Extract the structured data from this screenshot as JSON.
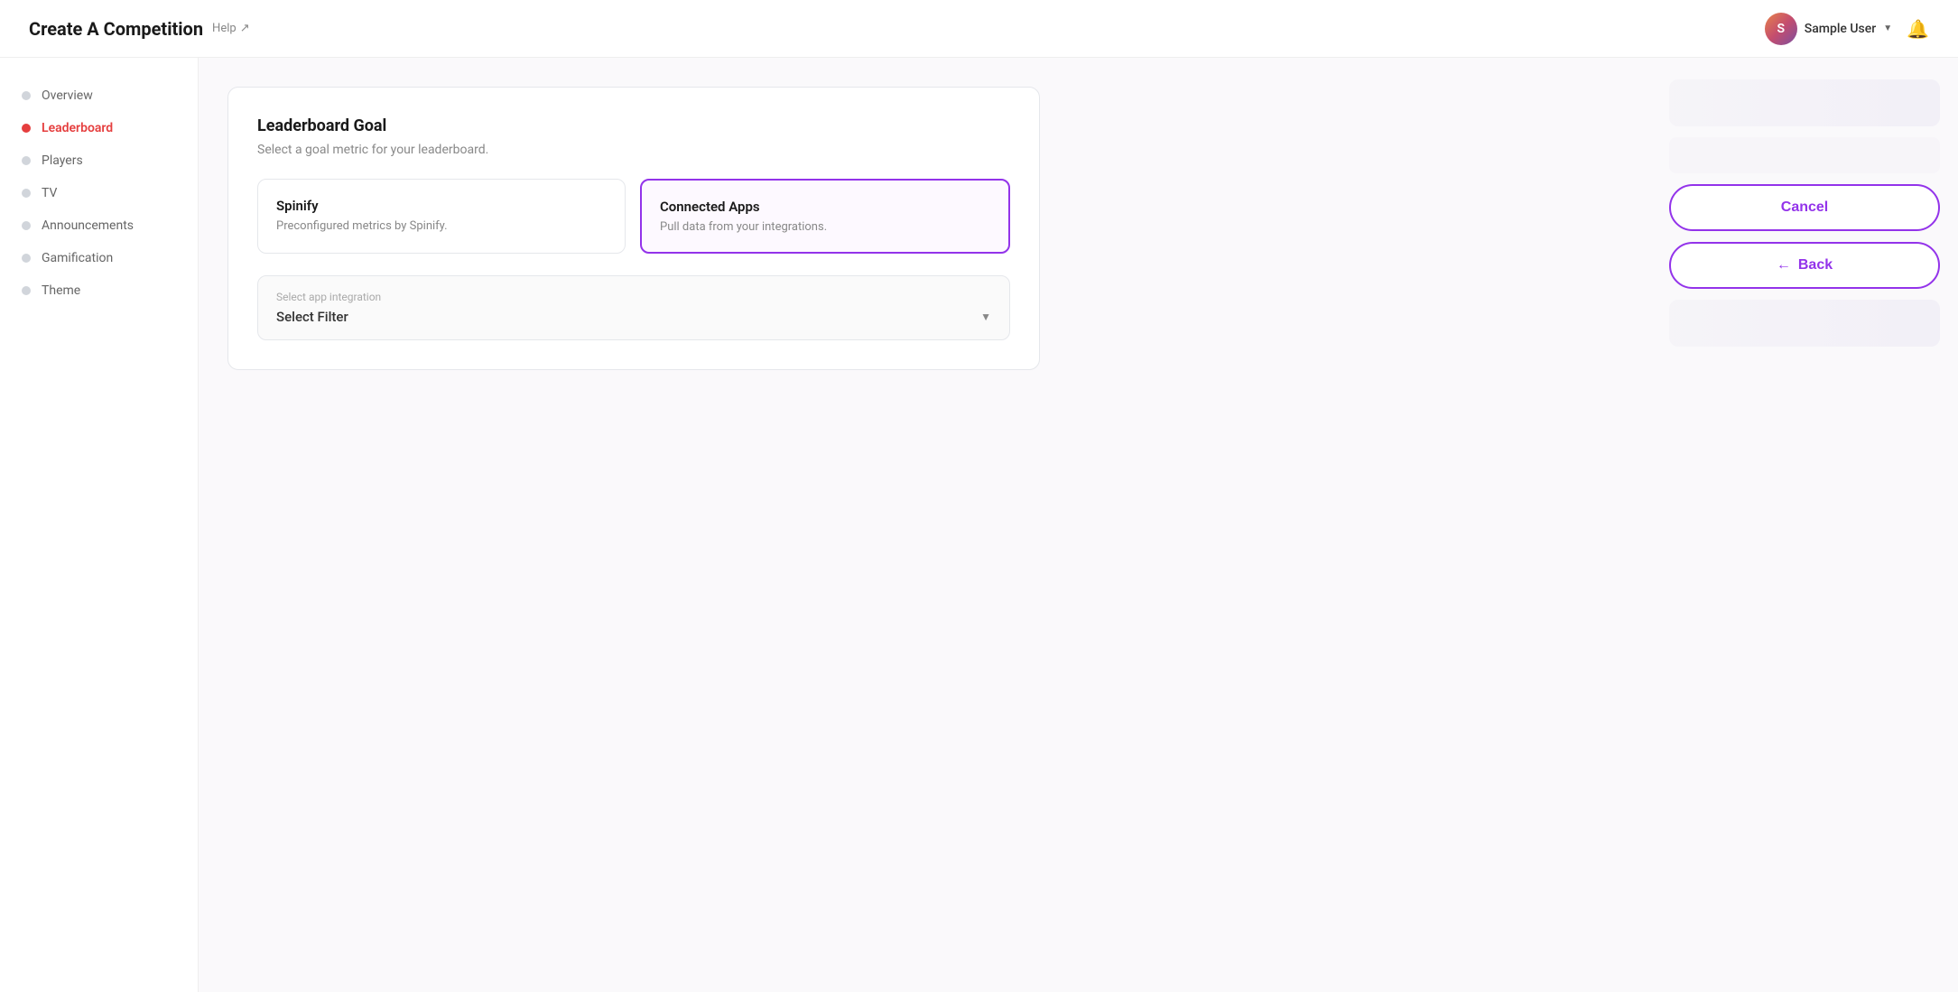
{
  "header": {
    "title": "Create A Competition",
    "help_label": "Help",
    "user_name": "Sample User"
  },
  "sidebar": {
    "items": [
      {
        "id": "overview",
        "label": "Overview",
        "active": false
      },
      {
        "id": "leaderboard",
        "label": "Leaderboard",
        "active": true
      },
      {
        "id": "players",
        "label": "Players",
        "active": false
      },
      {
        "id": "tv",
        "label": "TV",
        "active": false
      },
      {
        "id": "announcements",
        "label": "Announcements",
        "active": false
      },
      {
        "id": "gamification",
        "label": "Gamification",
        "active": false
      },
      {
        "id": "theme",
        "label": "Theme",
        "active": false
      }
    ]
  },
  "main": {
    "card": {
      "title": "Leaderboard Goal",
      "subtitle": "Select a goal metric for your leaderboard.",
      "option_spinify": {
        "title": "Spinify",
        "desc": "Preconfigured metrics by Spinify."
      },
      "option_connected": {
        "title": "Connected Apps",
        "desc": "Pull data from your integrations.",
        "selected": true
      },
      "filter": {
        "label": "Select app integration",
        "placeholder": "Select Filter"
      }
    }
  },
  "right_panel": {
    "cancel_label": "Cancel",
    "back_label": "Back"
  }
}
